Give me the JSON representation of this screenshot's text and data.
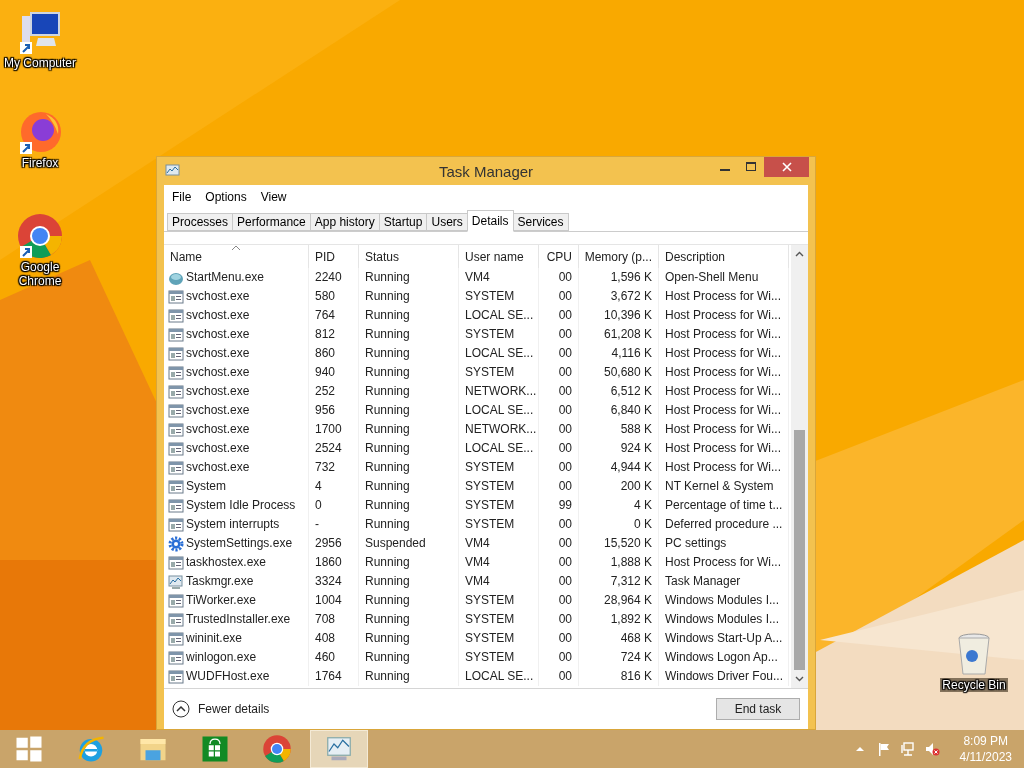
{
  "desktop_icons": [
    {
      "kind": "computer",
      "label": "My Computer"
    },
    {
      "kind": "firefox",
      "label": "Firefox"
    },
    {
      "kind": "chrome",
      "label": "Google Chrome"
    },
    {
      "kind": "recycle",
      "label": "Recycle Bin"
    }
  ],
  "window": {
    "title": "Task Manager"
  },
  "menu": [
    "File",
    "Options",
    "View"
  ],
  "tabs": [
    {
      "label": "Processes",
      "selected": false
    },
    {
      "label": "Performance",
      "selected": false
    },
    {
      "label": "App history",
      "selected": false
    },
    {
      "label": "Startup",
      "selected": false
    },
    {
      "label": "Users",
      "selected": false
    },
    {
      "label": "Details",
      "selected": true
    },
    {
      "label": "Services",
      "selected": false
    }
  ],
  "table": {
    "columns": [
      {
        "label": "Name",
        "sorted": true
      },
      {
        "label": "PID",
        "sorted": false
      },
      {
        "label": "Status",
        "sorted": false
      },
      {
        "label": "User name",
        "sorted": false
      },
      {
        "label": "CPU",
        "sorted": false
      },
      {
        "label": "Memory (p...",
        "sorted": false
      },
      {
        "label": "Description",
        "sorted": false
      }
    ],
    "rows": [
      {
        "kind": "shell",
        "cells": [
          "StartMenu.exe",
          "2240",
          "Running",
          "VM4",
          "00",
          "1,596 K",
          "Open-Shell Menu"
        ]
      },
      {
        "kind": "exe",
        "cells": [
          "svchost.exe",
          "580",
          "Running",
          "SYSTEM",
          "00",
          "3,672 K",
          "Host Process for Wi..."
        ]
      },
      {
        "kind": "exe",
        "cells": [
          "svchost.exe",
          "764",
          "Running",
          "LOCAL SE...",
          "00",
          "10,396 K",
          "Host Process for Wi..."
        ]
      },
      {
        "kind": "exe",
        "cells": [
          "svchost.exe",
          "812",
          "Running",
          "SYSTEM",
          "00",
          "61,208 K",
          "Host Process for Wi..."
        ]
      },
      {
        "kind": "exe",
        "cells": [
          "svchost.exe",
          "860",
          "Running",
          "LOCAL SE...",
          "00",
          "4,116 K",
          "Host Process for Wi..."
        ]
      },
      {
        "kind": "exe",
        "cells": [
          "svchost.exe",
          "940",
          "Running",
          "SYSTEM",
          "00",
          "50,680 K",
          "Host Process for Wi..."
        ]
      },
      {
        "kind": "exe",
        "cells": [
          "svchost.exe",
          "252",
          "Running",
          "NETWORK...",
          "00",
          "6,512 K",
          "Host Process for Wi..."
        ]
      },
      {
        "kind": "exe",
        "cells": [
          "svchost.exe",
          "956",
          "Running",
          "LOCAL SE...",
          "00",
          "6,840 K",
          "Host Process for Wi..."
        ]
      },
      {
        "kind": "exe",
        "cells": [
          "svchost.exe",
          "1700",
          "Running",
          "NETWORK...",
          "00",
          "588 K",
          "Host Process for Wi..."
        ]
      },
      {
        "kind": "exe",
        "cells": [
          "svchost.exe",
          "2524",
          "Running",
          "LOCAL SE...",
          "00",
          "924 K",
          "Host Process for Wi..."
        ]
      },
      {
        "kind": "exe",
        "cells": [
          "svchost.exe",
          "732",
          "Running",
          "SYSTEM",
          "00",
          "4,944 K",
          "Host Process for Wi..."
        ]
      },
      {
        "kind": "exe",
        "cells": [
          "System",
          "4",
          "Running",
          "SYSTEM",
          "00",
          "200 K",
          "NT Kernel & System"
        ]
      },
      {
        "kind": "exe",
        "cells": [
          "System Idle Process",
          "0",
          "Running",
          "SYSTEM",
          "99",
          "4 K",
          "Percentage of time t..."
        ]
      },
      {
        "kind": "exe",
        "cells": [
          "System interrupts",
          "-",
          "Running",
          "SYSTEM",
          "00",
          "0 K",
          "Deferred procedure ..."
        ]
      },
      {
        "kind": "gear",
        "cells": [
          "SystemSettings.exe",
          "2956",
          "Suspended",
          "VM4",
          "00",
          "15,520 K",
          "PC settings"
        ]
      },
      {
        "kind": "exe",
        "cells": [
          "taskhostex.exe",
          "1860",
          "Running",
          "VM4",
          "00",
          "1,888 K",
          "Host Process for Wi..."
        ]
      },
      {
        "kind": "taskmgr",
        "cells": [
          "Taskmgr.exe",
          "3324",
          "Running",
          "VM4",
          "00",
          "7,312 K",
          "Task Manager"
        ]
      },
      {
        "kind": "exe",
        "cells": [
          "TiWorker.exe",
          "1004",
          "Running",
          "SYSTEM",
          "00",
          "28,964 K",
          "Windows Modules I..."
        ]
      },
      {
        "kind": "exe",
        "cells": [
          "TrustedInstaller.exe",
          "708",
          "Running",
          "SYSTEM",
          "00",
          "1,892 K",
          "Windows Modules I..."
        ]
      },
      {
        "kind": "exe",
        "cells": [
          "wininit.exe",
          "408",
          "Running",
          "SYSTEM",
          "00",
          "468 K",
          "Windows Start-Up A..."
        ]
      },
      {
        "kind": "exe",
        "cells": [
          "winlogon.exe",
          "460",
          "Running",
          "SYSTEM",
          "00",
          "724 K",
          "Windows Logon Ap..."
        ]
      },
      {
        "kind": "exe",
        "cells": [
          "WUDFHost.exe",
          "1764",
          "Running",
          "LOCAL SE...",
          "00",
          "816 K",
          "Windows Driver Fou..."
        ]
      }
    ]
  },
  "footer": {
    "fewer_details": "Fewer details",
    "end_task": "End task"
  },
  "taskbar": {
    "items": [
      {
        "kind": "start",
        "selected": false
      },
      {
        "kind": "ie",
        "selected": false
      },
      {
        "kind": "explorer",
        "selected": false
      },
      {
        "kind": "store",
        "selected": false
      },
      {
        "kind": "chrome",
        "selected": false
      },
      {
        "kind": "taskmgr",
        "selected": true
      }
    ],
    "tray": {
      "time": "8:09 PM",
      "date": "4/11/2023"
    }
  }
}
